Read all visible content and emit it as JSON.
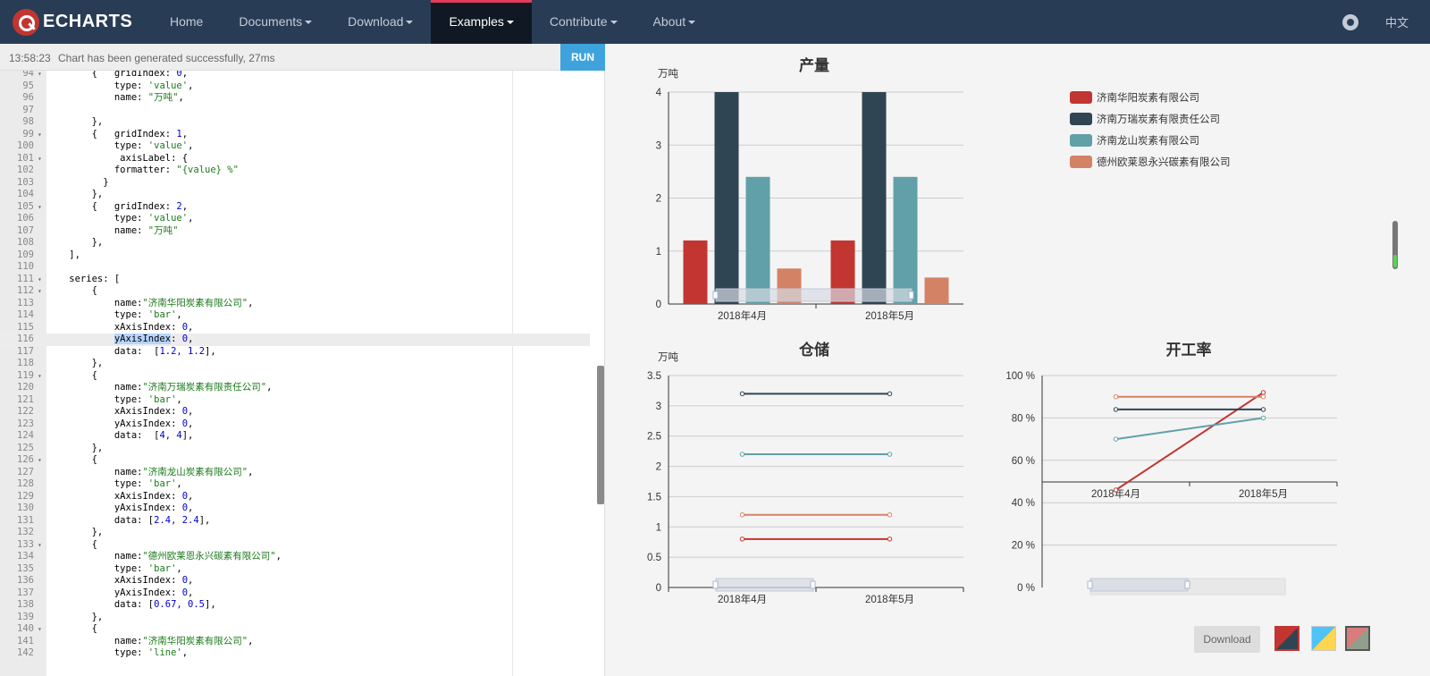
{
  "navbar": {
    "logo": "ECHARTS",
    "items": [
      {
        "label": "Home",
        "caret": false
      },
      {
        "label": "Documents",
        "caret": true
      },
      {
        "label": "Download",
        "caret": true
      },
      {
        "label": "Examples",
        "caret": true,
        "active": true
      },
      {
        "label": "Contribute",
        "caret": true
      },
      {
        "label": "About",
        "caret": true
      }
    ],
    "lang": "中文",
    "github_icon": "github-icon"
  },
  "status": {
    "time": "13:58:23",
    "message": "Chart has been generated successfully, 27ms",
    "run_label": "RUN"
  },
  "editor": {
    "first_line": 94,
    "active_line": 116,
    "lines": [
      {
        "n": 94,
        "fold": true,
        "text": "        {   gridIndex: 0,"
      },
      {
        "n": 95,
        "text": "            type: 'value',"
      },
      {
        "n": 96,
        "text": "            name: \"万吨\","
      },
      {
        "n": 97,
        "text": ""
      },
      {
        "n": 98,
        "text": "        },"
      },
      {
        "n": 99,
        "fold": true,
        "text": "        {   gridIndex: 1,"
      },
      {
        "n": 100,
        "text": "            type: 'value',"
      },
      {
        "n": 101,
        "fold": true,
        "text": "             axisLabel: {"
      },
      {
        "n": 102,
        "text": "            formatter: \"{value} %\""
      },
      {
        "n": 103,
        "text": "          }"
      },
      {
        "n": 104,
        "text": "        },"
      },
      {
        "n": 105,
        "fold": true,
        "text": "        {   gridIndex: 2,"
      },
      {
        "n": 106,
        "text": "            type: 'value',"
      },
      {
        "n": 107,
        "text": "            name: \"万吨\""
      },
      {
        "n": 108,
        "text": "        },"
      },
      {
        "n": 109,
        "text": "    ],"
      },
      {
        "n": 110,
        "text": ""
      },
      {
        "n": 111,
        "fold": true,
        "text": "    series: ["
      },
      {
        "n": 112,
        "fold": true,
        "text": "        {"
      },
      {
        "n": 113,
        "text": "            name:\"济南华阳炭素有限公司\","
      },
      {
        "n": 114,
        "text": "            type: 'bar',"
      },
      {
        "n": 115,
        "text": "            xAxisIndex: 0,"
      },
      {
        "n": 116,
        "text": "            yAxisIndex: 0,"
      },
      {
        "n": 117,
        "text": "            data:  [1.2, 1.2],"
      },
      {
        "n": 118,
        "text": "        },"
      },
      {
        "n": 119,
        "fold": true,
        "text": "        {"
      },
      {
        "n": 120,
        "text": "            name:\"济南万瑞炭素有限责任公司\","
      },
      {
        "n": 121,
        "text": "            type: 'bar',"
      },
      {
        "n": 122,
        "text": "            xAxisIndex: 0,"
      },
      {
        "n": 123,
        "text": "            yAxisIndex: 0,"
      },
      {
        "n": 124,
        "text": "            data:  [4, 4],"
      },
      {
        "n": 125,
        "text": "        },"
      },
      {
        "n": 126,
        "fold": true,
        "text": "        {"
      },
      {
        "n": 127,
        "text": "            name:\"济南龙山炭素有限公司\","
      },
      {
        "n": 128,
        "text": "            type: 'bar',"
      },
      {
        "n": 129,
        "text": "            xAxisIndex: 0,"
      },
      {
        "n": 130,
        "text": "            yAxisIndex: 0,"
      },
      {
        "n": 131,
        "text": "            data: [2.4, 2.4],"
      },
      {
        "n": 132,
        "text": "        },"
      },
      {
        "n": 133,
        "fold": true,
        "text": "        {"
      },
      {
        "n": 134,
        "text": "            name:\"德州欧莱恩永兴碳素有限公司\","
      },
      {
        "n": 135,
        "text": "            type: 'bar',"
      },
      {
        "n": 136,
        "text": "            xAxisIndex: 0,"
      },
      {
        "n": 137,
        "text": "            yAxisIndex: 0,"
      },
      {
        "n": 138,
        "text": "            data: [0.67, 0.5],"
      },
      {
        "n": 139,
        "text": "        },"
      },
      {
        "n": 140,
        "fold": true,
        "text": "        {"
      },
      {
        "n": 141,
        "text": "            name:\"济南华阳炭素有限公司\","
      },
      {
        "n": 142,
        "text": "            type: 'line',"
      }
    ]
  },
  "colors": {
    "s1": "#c23531",
    "s2": "#2f4554",
    "s3": "#61a0a8",
    "s4": "#d48265"
  },
  "legend": [
    "济南华阳炭素有限公司",
    "济南万瑞炭素有限责任公司",
    "济南龙山炭素有限公司",
    "德州欧莱恩永兴碳素有限公司"
  ],
  "chart_data": [
    {
      "type": "bar",
      "title": "产量",
      "ylabel": "万吨",
      "categories": [
        "2018年4月",
        "2018年5月"
      ],
      "ylim": [
        0,
        4
      ],
      "yticks": [
        "0",
        "1",
        "2",
        "3",
        "4"
      ],
      "series": [
        {
          "name": "济南华阳炭素有限公司",
          "values": [
            1.2,
            1.2
          ]
        },
        {
          "name": "济南万瑞炭素有限责任公司",
          "values": [
            4,
            4
          ]
        },
        {
          "name": "济南龙山炭素有限公司",
          "values": [
            2.4,
            2.4
          ]
        },
        {
          "name": "德州欧莱恩永兴碳素有限公司",
          "values": [
            0.67,
            0.5
          ]
        }
      ]
    },
    {
      "type": "line",
      "title": "仓储",
      "ylabel": "万吨",
      "categories": [
        "2018年4月",
        "2018年5月"
      ],
      "ylim": [
        0,
        3.5
      ],
      "yticks": [
        "0",
        "0.5",
        "1",
        "1.5",
        "2",
        "2.5",
        "3",
        "3.5"
      ],
      "series": [
        {
          "name": "济南华阳炭素有限公司",
          "values": [
            0.8,
            0.8
          ]
        },
        {
          "name": "济南万瑞炭素有限责任公司",
          "values": [
            3.2,
            3.2
          ]
        },
        {
          "name": "济南龙山炭素有限公司",
          "values": [
            2.2,
            2.2
          ]
        },
        {
          "name": "德州欧莱恩永兴碳素有限公司",
          "values": [
            1.2,
            1.2
          ]
        }
      ]
    },
    {
      "type": "line",
      "title": "开工率",
      "ylabel": "",
      "categories": [
        "2018年4月",
        "2018年5月"
      ],
      "ylim": [
        0,
        100
      ],
      "yticks": [
        "0 %",
        "20 %",
        "40 %",
        "60 %",
        "80 %",
        "100 %"
      ],
      "series": [
        {
          "name": "济南华阳炭素有限公司",
          "values": [
            46,
            92
          ]
        },
        {
          "name": "济南万瑞炭素有限责任公司",
          "values": [
            84,
            84
          ]
        },
        {
          "name": "济南龙山炭素有限公司",
          "values": [
            70,
            80
          ]
        },
        {
          "name": "德州欧莱恩永兴碳素有限公司",
          "values": [
            90,
            90
          ]
        }
      ]
    }
  ],
  "download_label": "Download",
  "themes": [
    "theme-default",
    "theme-light",
    "theme-vintage"
  ]
}
